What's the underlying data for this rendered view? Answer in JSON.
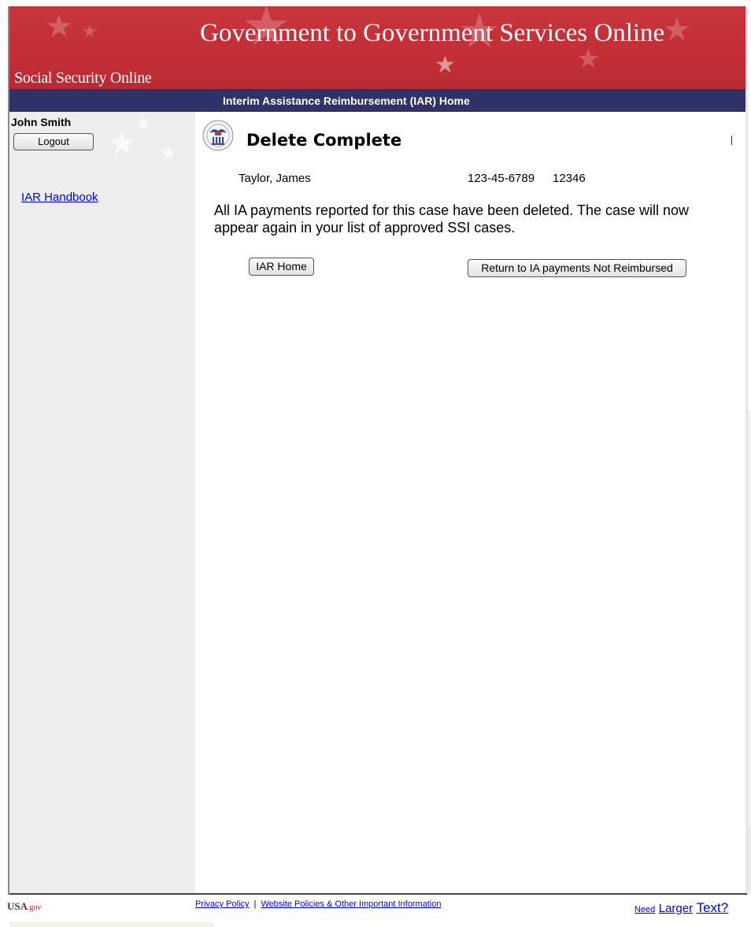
{
  "header": {
    "brand": "Social Security Online",
    "site_title": "Government to Government Services Online"
  },
  "navbar": {
    "title": "Interim Assistance Reimbursement (IAR) Home"
  },
  "sidebar": {
    "user_name": "John Smith",
    "logout_label": "Logout",
    "handbook_link": "IAR Handbook"
  },
  "main": {
    "page_title": "Delete Complete",
    "case": {
      "name": "Taylor, James",
      "ssn": "123-45-6789",
      "number": "12346"
    },
    "message": "All IA payments reported for this case have been deleted. The case will now appear again in your list of approved SSI cases.",
    "buttons": {
      "home": "IAR Home",
      "return": "Return to IA payments Not Reimbursed"
    }
  },
  "footer": {
    "logo_main": "USA",
    "logo_suffix": ".gov",
    "privacy_link": "Privacy Policy",
    "separator": "|",
    "policies_link": "Website Policies & Other Important Information",
    "larger_text": {
      "need": "Need",
      "larger": "Larger",
      "text": "Text?"
    }
  },
  "colors": {
    "banner": "#c42f37",
    "navbar": "#2e3266",
    "sidebar": "#eeeeee",
    "link": "#0000ee"
  }
}
